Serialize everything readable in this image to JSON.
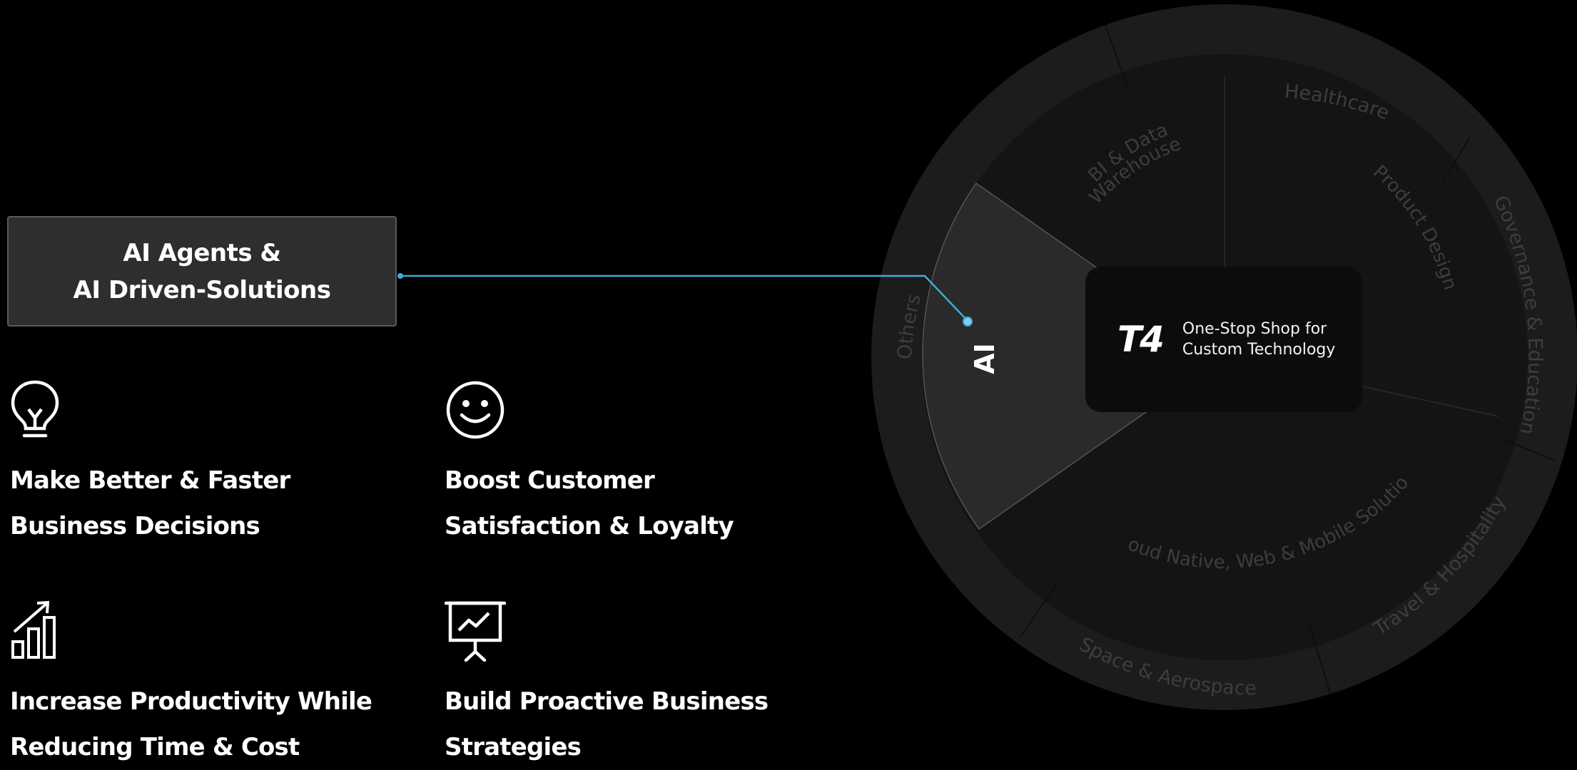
{
  "callout": {
    "line1": "AI Agents &",
    "line2": "AI Driven-Solutions"
  },
  "benefits": [
    {
      "icon": "lightbulb-icon",
      "line1": "Make Better & Faster",
      "line2": "Business Decisions"
    },
    {
      "icon": "smiley-face-icon",
      "line1": "Boost Customer",
      "line2": "Satisfaction & Loyalty"
    },
    {
      "icon": "growth-chart-icon",
      "line1": "Increase Productivity While",
      "line2": "Reducing Time & Cost"
    },
    {
      "icon": "presentation-board-icon",
      "line1": "Build Proactive Business",
      "line2": "Strategies"
    }
  ],
  "wheel": {
    "center": {
      "logo": "T4",
      "tagline_line1": "One-Stop Shop for",
      "tagline_line2": "Custom Technology"
    },
    "highlighted_segment": "AI",
    "inner_segments": {
      "bi_line1": "BI & Data",
      "bi_line2": "Warehouse",
      "product_design": "Product Design",
      "cloud": "Cloud Native, Web & Mobile Solutions"
    },
    "outer_segments": {
      "others": "Others",
      "healthcare": "Healthcare",
      "governance": "Governance & Education",
      "travel": "Travel & Hospitality",
      "space": "Space & Aerospace"
    }
  },
  "colors": {
    "background": "#000000",
    "connector": "#3aaed8",
    "outer_ring": "#1c1c1c",
    "inner_disc": "#141414",
    "highlight_wedge": "#2a2a2a",
    "muted_label": "#3d3d3d"
  }
}
